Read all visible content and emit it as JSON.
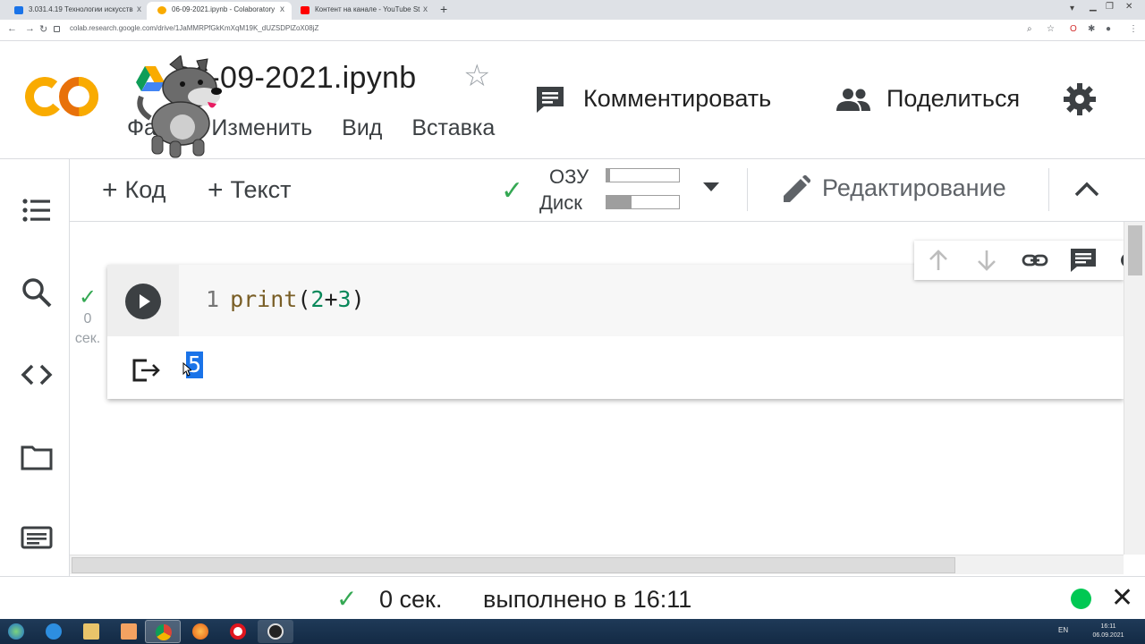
{
  "browser": {
    "tabs": [
      {
        "title": "3.031.4.19 Технологии искусств",
        "favicon_color": "#1a73e8"
      },
      {
        "title": "06-09-2021.ipynb - Colaboratory",
        "favicon_color": "#f9ab00"
      },
      {
        "title": "Контент на канале - YouTube St",
        "favicon_color": "#ff0000"
      }
    ],
    "new_tab": "+",
    "tab_close": "x",
    "url": "colab.research.google.com/drive/1JaMMRPfGkKmXqM19K_dUZSDPlZoX08jZ"
  },
  "header": {
    "logo_text": "CO",
    "title": "06-09-2021.ipynb",
    "star_icon": "☆",
    "menu": [
      "Файл",
      "Изменить",
      "Вид",
      "Вставка"
    ],
    "comment_label": "Комментировать",
    "share_label": "Поделиться"
  },
  "toolbar": {
    "add_code": "Код",
    "add_text": "Текст",
    "plus": "+",
    "ram_label": "ОЗУ",
    "disk_label": "Диск",
    "ram_usage": 0.05,
    "disk_usage": 0.35,
    "edit_label": "Редактирование"
  },
  "cell": {
    "line_number": "1",
    "code_fn": "print",
    "code_open": "(",
    "code_a": "2",
    "code_op": "+",
    "code_b": "3",
    "code_close": ")",
    "output": "5",
    "exec_time_value": "0",
    "exec_time_unit": "сек."
  },
  "status": {
    "time": "0 сек.",
    "message": "выполнено в 16:11",
    "close": "✕"
  },
  "taskbar": {
    "lang": "EN",
    "time": "16:11",
    "date": "06.09.2021"
  },
  "colors": {
    "accent_orange": "#f9ab00",
    "success_green": "#34a853",
    "selection_blue": "#1a73e8"
  }
}
